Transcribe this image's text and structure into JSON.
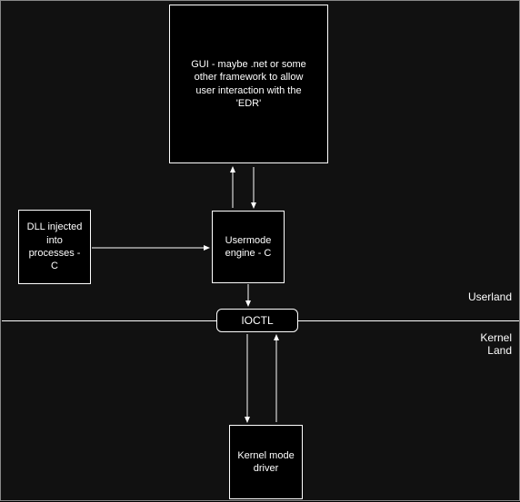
{
  "boxes": {
    "gui": "GUI - maybe .net or some other framework to allow user interaction with the 'EDR'",
    "dll": "DLL injected into processes - C",
    "usermode": "Usermode engine - C",
    "ioctl": "IOCTL",
    "kernel": "Kernel mode driver"
  },
  "regions": {
    "userland": "Userland",
    "kernelland": "Kernel Land"
  }
}
